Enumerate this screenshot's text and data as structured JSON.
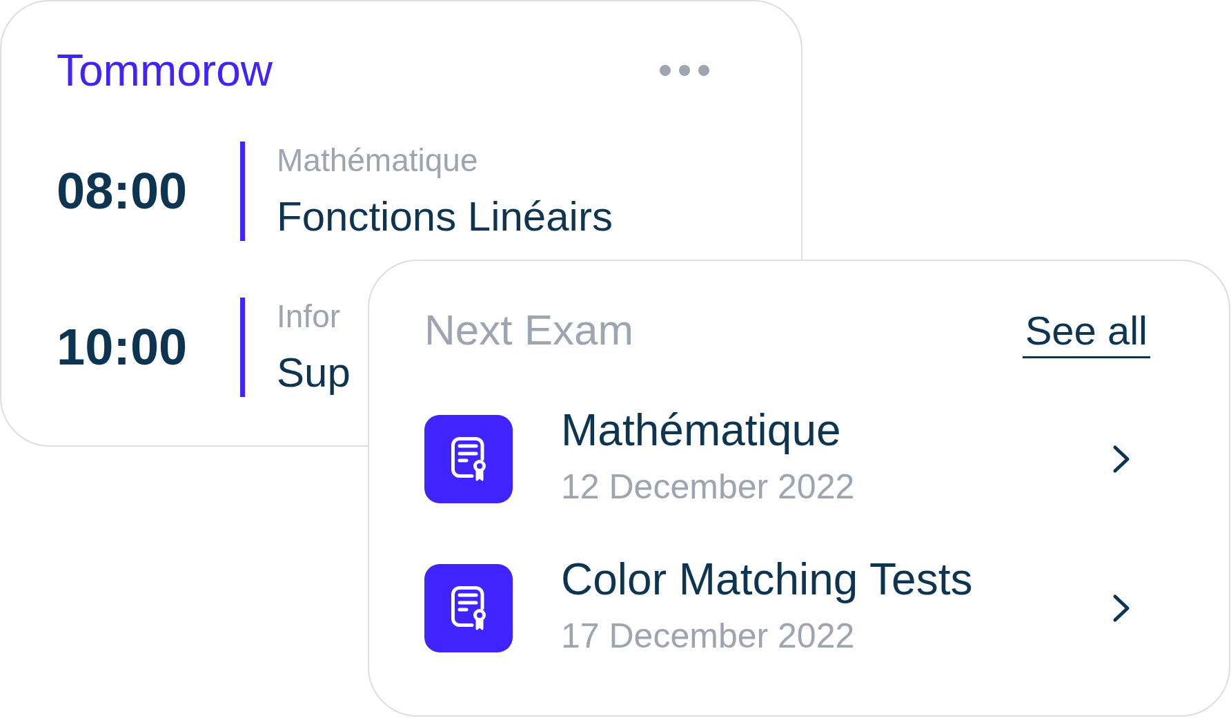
{
  "schedule_card": {
    "title": "Tommorow",
    "sessions": [
      {
        "time": "08:00",
        "subject": "Mathématique",
        "topic": "Fonctions Linéairs"
      },
      {
        "time": "10:00",
        "subject": "Infor",
        "topic": "Sup"
      }
    ]
  },
  "exam_card": {
    "title": "Next Exam",
    "link": "See all",
    "exams": [
      {
        "name": "Mathématique",
        "date": "12 December 2022"
      },
      {
        "name": "Color Matching Tests",
        "date": "17 December 2022"
      }
    ]
  }
}
